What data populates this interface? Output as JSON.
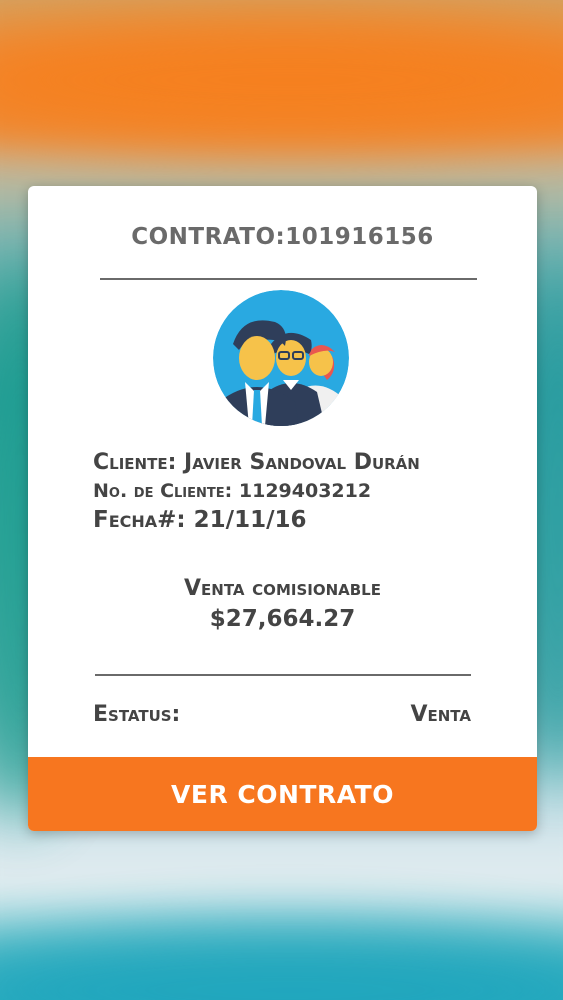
{
  "contract": {
    "title": "CONTRATO:101916156"
  },
  "client": {
    "name_label": "Cliente:",
    "name_value": "Javier Sandoval Durán",
    "number_label": "No. de Cliente:",
    "number_value": "1129403212",
    "date_label": "Fecha#:",
    "date_value": "21/11/16"
  },
  "sale": {
    "label": "Venta comisionable",
    "amount": "$27,664.27"
  },
  "status": {
    "label": "Estatus:",
    "value": "Venta"
  },
  "actions": {
    "view_contract_label": "VER CONTRATO"
  },
  "colors": {
    "accent": "#f7761f",
    "text": "#444444",
    "avatar_bg": "#29a9e1"
  },
  "icons": {
    "avatar": "people-group-icon"
  }
}
